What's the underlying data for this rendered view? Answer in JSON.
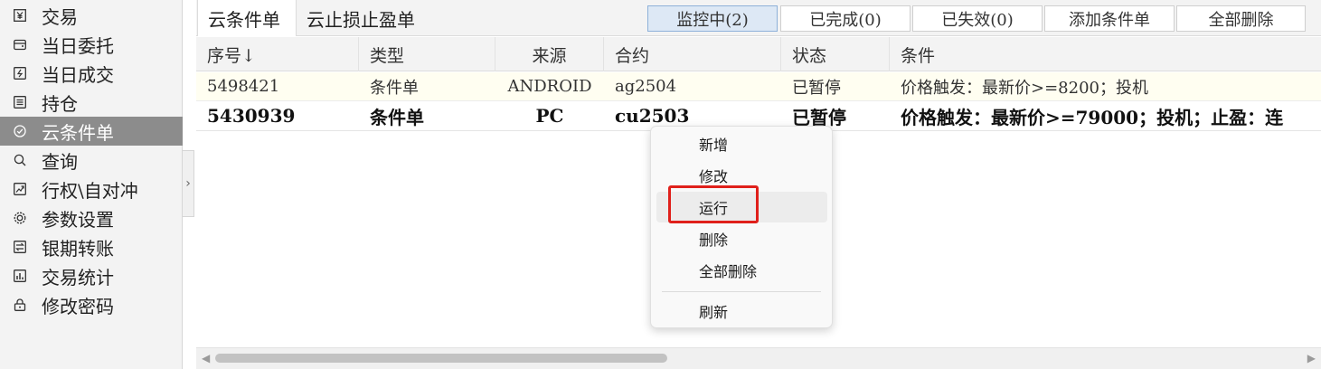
{
  "sidebar": {
    "items": [
      {
        "label": "交易",
        "icon": "yen-icon"
      },
      {
        "label": "当日委托",
        "icon": "wallet-icon"
      },
      {
        "label": "当日成交",
        "icon": "deal-icon"
      },
      {
        "label": "持仓",
        "icon": "list-icon"
      },
      {
        "label": "云条件单",
        "icon": "check-circle-icon",
        "active": true
      },
      {
        "label": "查询",
        "icon": "search-icon"
      },
      {
        "label": "行权\\自对冲",
        "icon": "chart-icon"
      },
      {
        "label": "参数设置",
        "icon": "gear-icon"
      },
      {
        "label": "银期转账",
        "icon": "transfer-icon"
      },
      {
        "label": "交易统计",
        "icon": "bar-chart-icon"
      },
      {
        "label": "修改密码",
        "icon": "lock-icon"
      }
    ],
    "collapse_glyph": "›"
  },
  "tabs": [
    {
      "label": "云条件单",
      "active": true
    },
    {
      "label": "云止损止盈单",
      "active": false
    }
  ],
  "toolbar": {
    "monitoring": "监控中(2)",
    "completed": "已完成(0)",
    "failed": "已失效(0)",
    "add": "添加条件单",
    "delete_all": "全部删除"
  },
  "table": {
    "columns": [
      "序号↓",
      "类型",
      "来源",
      "合约",
      "状态",
      "条件"
    ],
    "rows": [
      [
        "5498421",
        "条件单",
        "ANDROID",
        "ag2504",
        "已暂停",
        "价格触发：最新价>=8200；投机"
      ],
      [
        "5430939",
        "条件单",
        "PC",
        "cu2503",
        "已暂停",
        "价格触发：最新价>=79000；投机；止盈：连"
      ]
    ]
  },
  "context_menu": {
    "items": [
      "新增",
      "修改",
      "运行",
      "删除",
      "全部删除",
      "刷新"
    ],
    "highlighted": "运行"
  },
  "scrollbar": {
    "left_arrow": "◀",
    "right_arrow": "▶"
  },
  "colors": {
    "sidebar_active": "#8c8c8c",
    "selected_button": "#dde8f5",
    "row_highlight": "#fffef1",
    "annotation_red": "#e0201b"
  }
}
